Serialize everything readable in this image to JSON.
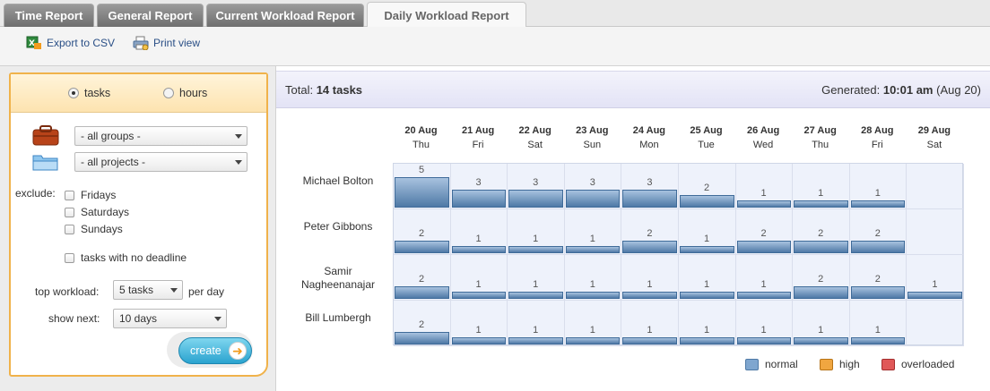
{
  "tabs": [
    {
      "label": "Time Report",
      "active": false
    },
    {
      "label": "General Report",
      "active": false
    },
    {
      "label": "Current Workload Report",
      "active": false
    },
    {
      "label": "Daily Workload Report",
      "active": true
    }
  ],
  "toolbar": {
    "export_label": "Export to CSV",
    "print_label": "Print view"
  },
  "filters": {
    "mode_tasks": "tasks",
    "mode_hours": "hours",
    "mode_selected": "tasks",
    "groups": "- all groups -",
    "projects": "- all projects -",
    "exclude_label": "exclude:",
    "exclude_fridays": "Fridays",
    "exclude_saturdays": "Saturdays",
    "exclude_sundays": "Sundays",
    "no_deadline": "tasks with no deadline",
    "top_workload_label": "top workload:",
    "top_workload_value": "5 tasks",
    "per_day": "per day",
    "show_next_label": "show next:",
    "show_next_value": "10 days",
    "create_label": "create"
  },
  "summary": {
    "total_label": "Total:",
    "total_value": "14 tasks",
    "generated_label": "Generated:",
    "generated_time": "10:01 am",
    "generated_date": "(Aug 20)"
  },
  "days": [
    {
      "date": "20 Aug",
      "weekday": "Thu"
    },
    {
      "date": "21 Aug",
      "weekday": "Fri"
    },
    {
      "date": "22 Aug",
      "weekday": "Sat"
    },
    {
      "date": "23 Aug",
      "weekday": "Sun"
    },
    {
      "date": "24 Aug",
      "weekday": "Mon"
    },
    {
      "date": "25 Aug",
      "weekday": "Tue"
    },
    {
      "date": "26 Aug",
      "weekday": "Wed"
    },
    {
      "date": "27 Aug",
      "weekday": "Thu"
    },
    {
      "date": "28 Aug",
      "weekday": "Fri"
    },
    {
      "date": "29 Aug",
      "weekday": "Sat"
    }
  ],
  "people": [
    {
      "name": "Michael Bolton",
      "values": [
        5,
        3,
        3,
        3,
        3,
        2,
        1,
        1,
        1,
        null
      ]
    },
    {
      "name": "Peter Gibbons",
      "values": [
        2,
        1,
        1,
        1,
        2,
        1,
        2,
        2,
        2,
        null
      ]
    },
    {
      "name": "Samir Nagheenanajar",
      "values": [
        2,
        1,
        1,
        1,
        1,
        1,
        1,
        2,
        2,
        1
      ]
    },
    {
      "name": "Bill Lumbergh",
      "values": [
        2,
        1,
        1,
        1,
        1,
        1,
        1,
        1,
        1,
        null
      ]
    }
  ],
  "max_workload": 5,
  "legend": [
    {
      "label": "normal",
      "color": "#7fa6cf"
    },
    {
      "label": "high",
      "color": "#f0a640"
    },
    {
      "label": "overloaded",
      "color": "#e05858"
    }
  ],
  "colors": {
    "normal_bar": "#5f87b3",
    "panel_border": "#f0b24a",
    "create_button": "#2aa3cf"
  }
}
